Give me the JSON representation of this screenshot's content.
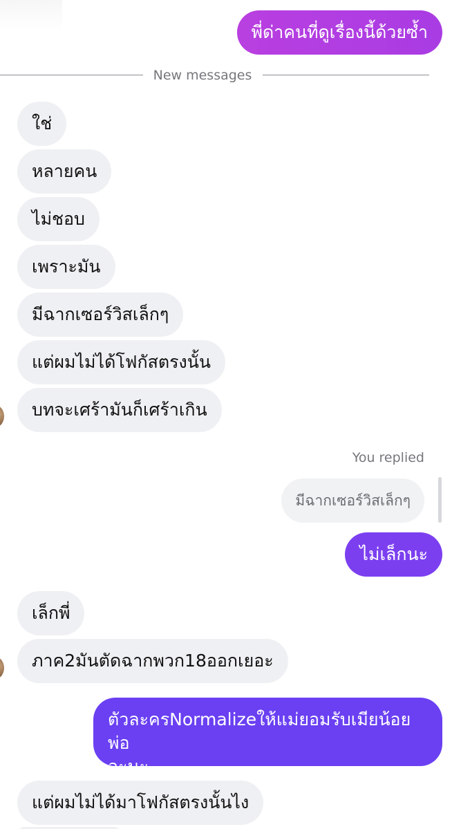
{
  "divider": {
    "label": "New messages"
  },
  "reply_context": {
    "label": "You replied",
    "quoted": "มีฉากเซอร์วิสเล็กๆ"
  },
  "messages": {
    "m0": "พี่ด่าคนที่ดูเรื่องนี้ด้วยซ้ำ",
    "m1": "ใช่",
    "m2": "หลายคน",
    "m3": "ไม่ชอบ",
    "m4": "เพราะมัน",
    "m5": "มีฉากเซอร์วิสเล็กๆ",
    "m6": "แต่ผมไม่ได้โฟกัสตรงนั้น",
    "m7": "บทจะเศร้ามันก็เศร้าเกิน",
    "m8": "ไม่เล็กนะ",
    "m9": "เล็กพี่",
    "m10": "ภาค2มันตัดฉากพวก18ออกเยอะ",
    "m11_line1": "ตัวละครNormalizeให้แม่ยอมรับเมียน้อยพ่อ",
    "m11_line2": "อะนะ",
    "m12": "แต่ผมไม่ได้มาโฟกัสตรงนั้นไง"
  },
  "colors": {
    "incoming_bubble": "#eff0f3",
    "outgoing_pink": "#b93fe0",
    "outgoing_purple": "#7c3ff0",
    "outgoing_violet": "#6a40f2"
  }
}
